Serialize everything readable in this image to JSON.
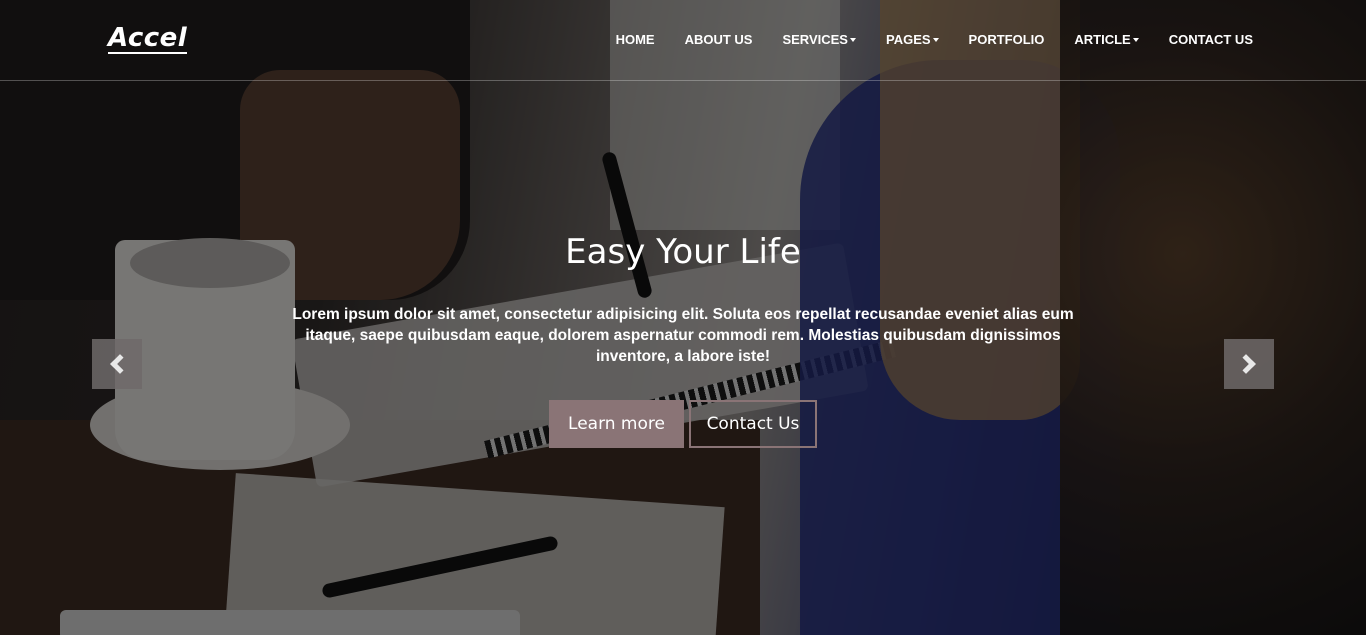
{
  "brand": {
    "logo_text": "Accel"
  },
  "nav": {
    "items": [
      {
        "label": "HOME",
        "dropdown": false
      },
      {
        "label": "ABOUT US",
        "dropdown": false
      },
      {
        "label": "SERVICES",
        "dropdown": true
      },
      {
        "label": "PAGES",
        "dropdown": true
      },
      {
        "label": "PORTFOLIO",
        "dropdown": false
      },
      {
        "label": "ARTICLE",
        "dropdown": true
      },
      {
        "label": "CONTACT US",
        "dropdown": false
      }
    ]
  },
  "hero": {
    "title": "Easy Your Life",
    "text": "Lorem ipsum dolor sit amet, consectetur adipisicing elit. Soluta eos repellat recusandae eveniet alias eum itaque, saepe quibusdam eaque, dolorem aspernatur commodi rem. Molestias quibusdam dignissimos inventore, a labore iste!",
    "learn_more_label": "Learn more",
    "contact_label": "Contact Us"
  },
  "carousel": {
    "prev_icon": "chevron-left-icon",
    "next_icon": "chevron-right-icon"
  },
  "colors": {
    "accent": "#8a7476",
    "text": "#ffffff"
  }
}
